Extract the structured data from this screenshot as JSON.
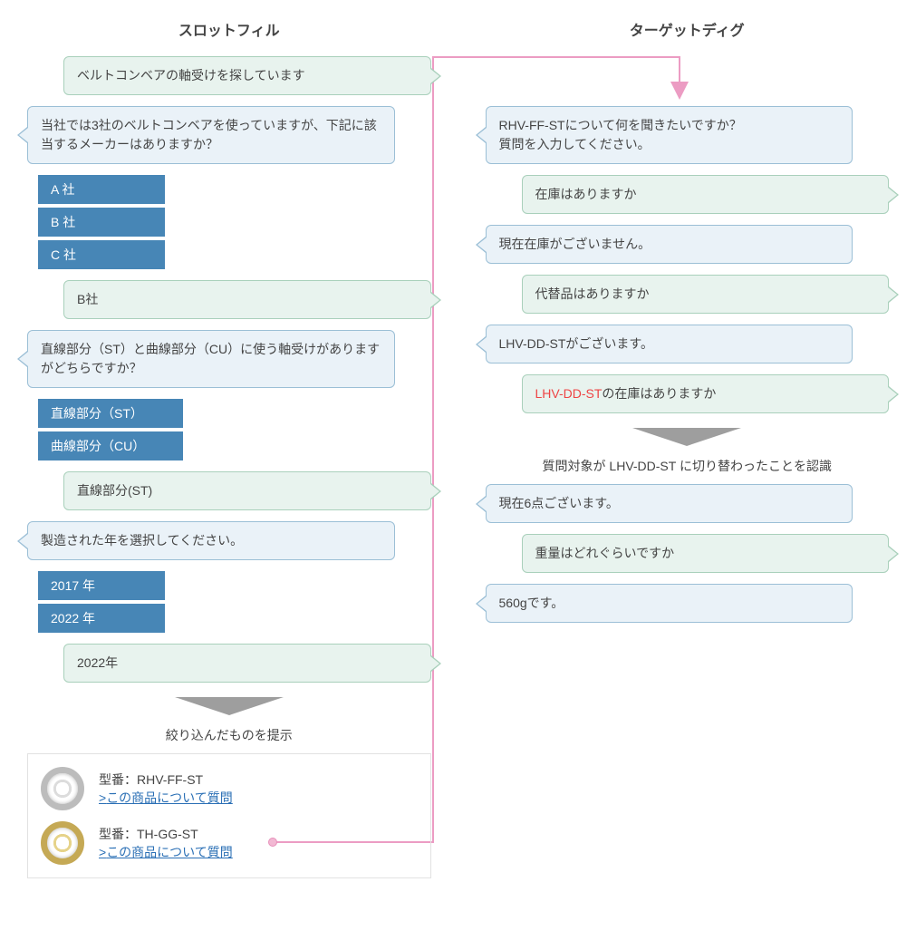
{
  "left": {
    "title": "スロットフィル",
    "msg1": "ベルトコンベアの軸受けを探しています",
    "msg2": "当社では3社のベルトコンベアを使っていますが、下記に該当するメーカーはありますか？",
    "opts_company": [
      "A 社",
      "B 社",
      "C 社"
    ],
    "ans1": "B社",
    "msg3": "直線部分（ST）と曲線部分（CU）に使う軸受けがありますがどちらですか？",
    "opts_part": [
      "直線部分（ST）",
      "曲線部分（CU）"
    ],
    "ans2": "直線部分(ST)",
    "msg4": "製造された年を選択してください。",
    "opts_year": [
      "2017 年",
      "2022 年"
    ],
    "ans3": "2022年",
    "caption": "絞り込んだものを提示",
    "products": [
      {
        "model_label": "型番：RHV-FF-ST",
        "link": "この商品について質問"
      },
      {
        "model_label": "型番：TH-GG-ST",
        "link": "この商品について質問"
      }
    ]
  },
  "right": {
    "title": "ターゲットディグ",
    "msg1": "RHV-FF-STについて何を聞きたいですか？\n質問を入力してください。",
    "q1": "在庫はありますか",
    "a1": "現在在庫がございません。",
    "q2": "代替品はありますか",
    "a2": "LHV-DD-STがございます。",
    "q3_prefix": "LHV-DD-ST",
    "q3_rest": "の在庫はありますか",
    "caption": "質問対象が LHV-DD-ST に切り替わったことを認識",
    "a3": "現在6点ございます。",
    "q4": "重量はどれぐらいですか",
    "a4": "560gです。"
  }
}
